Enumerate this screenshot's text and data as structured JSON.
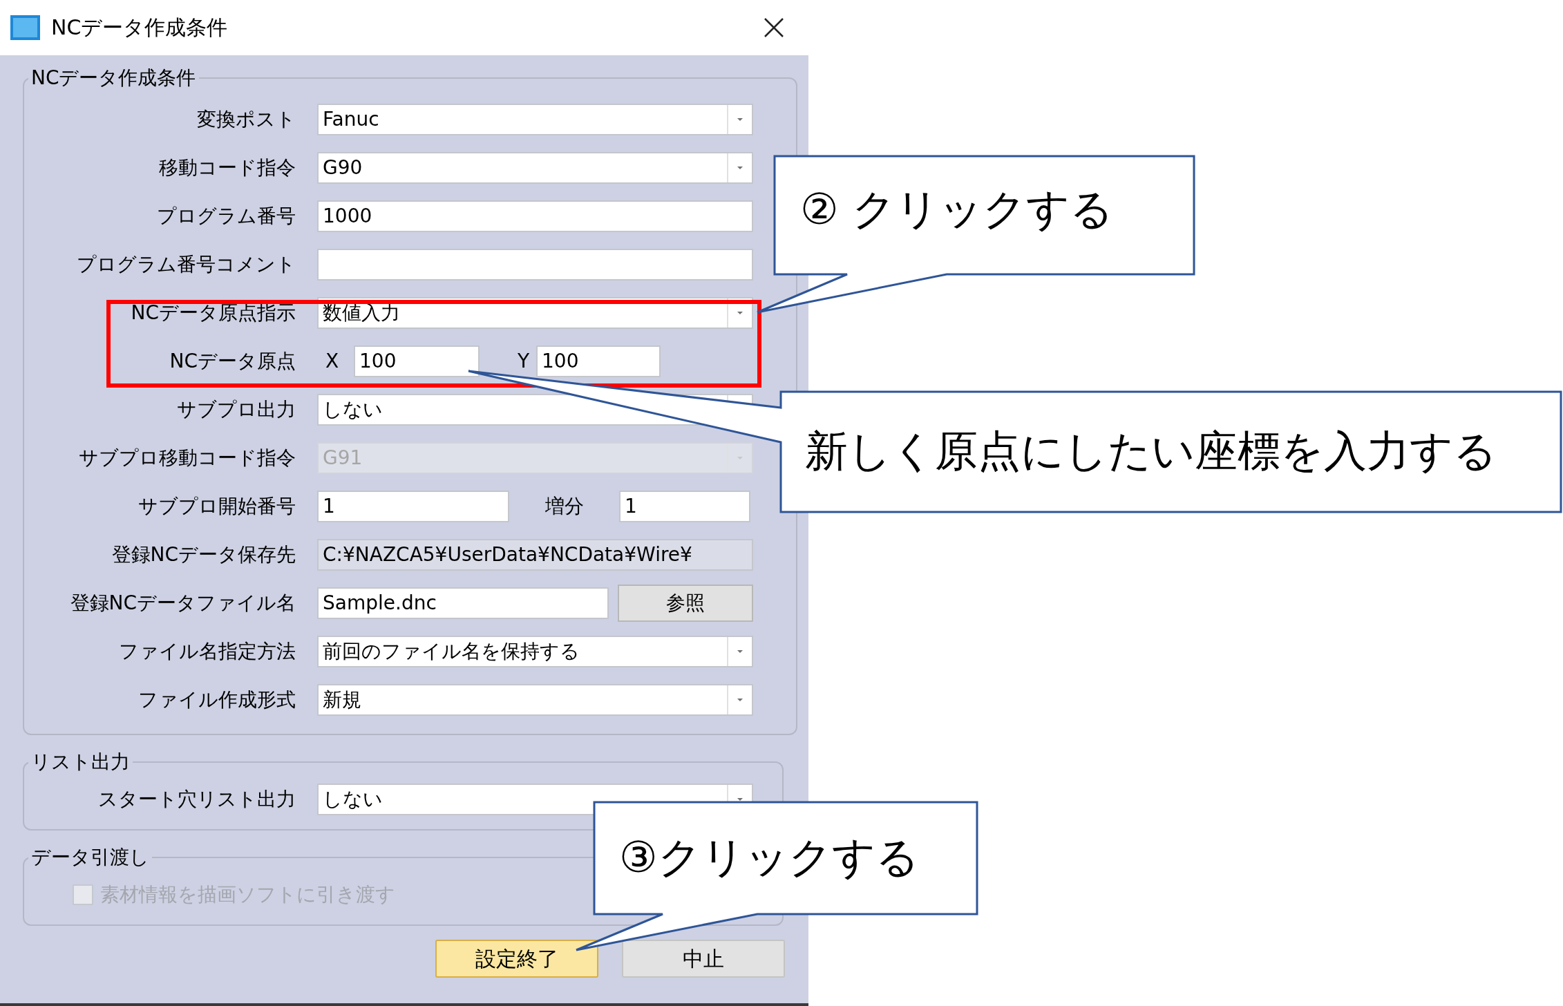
{
  "window": {
    "title": "NCデータ作成条件"
  },
  "groups": [
    {
      "title": "NCデータ作成条件",
      "rows": [
        {
          "kind": "dropdown",
          "label": "変換ポスト",
          "value": "Fanuc",
          "disabled": false
        },
        {
          "kind": "dropdown",
          "label": "移動コード指令",
          "value": "G90",
          "disabled": false
        },
        {
          "kind": "text",
          "label": "プログラム番号",
          "value": "1000"
        },
        {
          "kind": "text",
          "label": "プログラム番号コメント"
        },
        {
          "kind": "dropdown",
          "label": "NCデータ原点指示",
          "value": "数値入力",
          "disabled": false
        },
        {
          "kind": "xy",
          "label": "NCデータ原点",
          "x_label": "X",
          "x_value": "100",
          "y_label": "Y",
          "y_value": "100"
        },
        {
          "kind": "dropdown",
          "label": "サブプロ出力",
          "value": "しない",
          "disabled": false
        },
        {
          "kind": "dropdown",
          "label": "サブプロ移動コード指令",
          "value": "G91",
          "disabled": true
        },
        {
          "kind": "pair",
          "label": "サブプロ開始番号",
          "value": "1",
          "extra_label": "増分",
          "extra_value": "1"
        },
        {
          "kind": "readonly",
          "label": "登録NCデータ保存先",
          "value": "C:¥NAZCA5¥UserData¥NCData¥Wire¥"
        },
        {
          "kind": "browse",
          "label": "登録NCデータファイル名",
          "value": "Sample.dnc",
          "button": "参照"
        },
        {
          "kind": "dropdown",
          "label": "ファイル名指定方法",
          "value": "前回のファイル名を保持する",
          "disabled": false
        },
        {
          "kind": "dropdown",
          "label": "ファイル作成形式",
          "value": "新規",
          "disabled": false
        }
      ]
    },
    {
      "title": "リスト出力",
      "rows": [
        {
          "kind": "dropdown",
          "label": "スタート穴リスト出力",
          "value": "しない",
          "disabled": false
        }
      ]
    },
    {
      "title": "データ引渡し",
      "rows": [
        {
          "kind": "checkbox",
          "label": "素材情報を描画ソフトに引き渡す",
          "checked": false,
          "disabled": true
        }
      ]
    }
  ],
  "buttons": [
    {
      "label": "設定終了",
      "default": true
    },
    {
      "label": "中止",
      "default": false
    }
  ],
  "callouts": [
    {
      "text": "② クリックする"
    },
    {
      "text": "新しく原点にしたい座標を入力する"
    },
    {
      "text": "③クリックする"
    }
  ]
}
